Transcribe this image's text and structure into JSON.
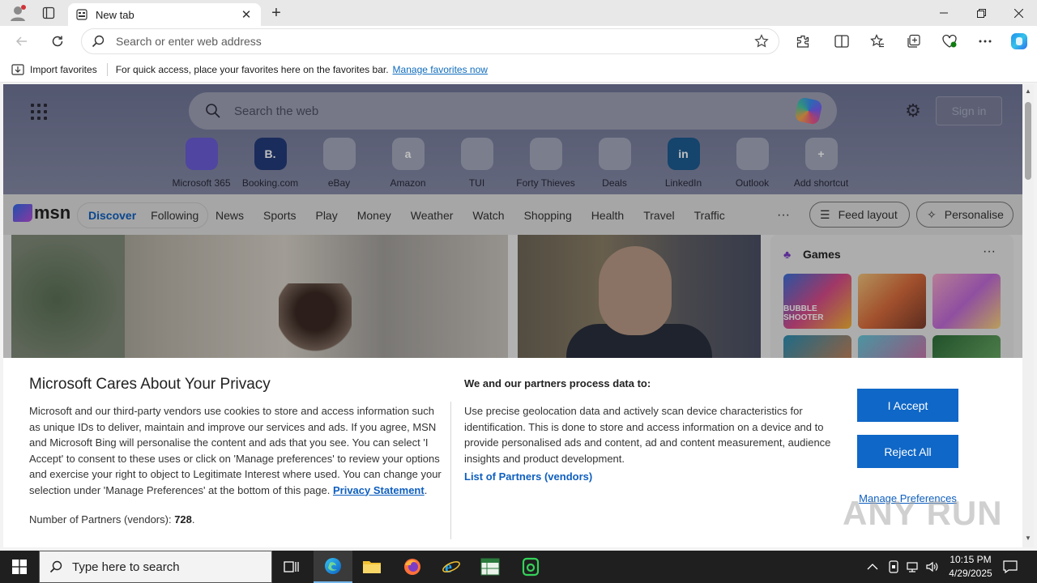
{
  "browser": {
    "tab": {
      "title": "New tab"
    },
    "address_bar": {
      "placeholder": "Search or enter web address"
    }
  },
  "favorites_bar": {
    "import_label": "Import favorites",
    "message": "For quick access, place your favorites here on the favorites bar.",
    "link": "Manage favorites now"
  },
  "newtab": {
    "search_placeholder": "Search the web",
    "sign_in": "Sign in",
    "shortcuts": [
      {
        "label": "Microsoft 365",
        "icon": "microsoft-365-icon",
        "glyph": "",
        "color": "#6b5cd6"
      },
      {
        "label": "Booking.com",
        "icon": "booking-icon",
        "glyph": "B.",
        "color": "#233b7a"
      },
      {
        "label": "eBay",
        "icon": "ebay-icon",
        "glyph": "",
        "color": "#a5a8bc"
      },
      {
        "label": "Amazon",
        "icon": "amazon-icon",
        "glyph": "a",
        "color": "#a5a8bc"
      },
      {
        "label": "TUI",
        "icon": "tui-icon",
        "glyph": "",
        "color": "#a5a8bc"
      },
      {
        "label": "Forty Thieves",
        "icon": "forty-thieves-icon",
        "glyph": "",
        "color": "#a5a8bc"
      },
      {
        "label": "Deals",
        "icon": "deals-icon",
        "glyph": "",
        "color": "#a5a8bc"
      },
      {
        "label": "LinkedIn",
        "icon": "linkedin-icon",
        "glyph": "in",
        "color": "#1c5b91"
      },
      {
        "label": "Outlook",
        "icon": "outlook-icon",
        "glyph": "",
        "color": "#a5a8bc"
      },
      {
        "label": "Add shortcut",
        "icon": "plus-icon",
        "glyph": "+",
        "color": "#a5a8bc"
      }
    ]
  },
  "msn": {
    "logo": "msn",
    "pill_tabs": [
      "Discover",
      "Following"
    ],
    "active_tab": "Discover",
    "nav": [
      "News",
      "Sports",
      "Play",
      "Money",
      "Weather",
      "Watch",
      "Shopping",
      "Health",
      "Travel",
      "Traffic"
    ],
    "more": "···",
    "feed_layout": "Feed layout",
    "personalise": "Personalise",
    "games": {
      "title": "Games",
      "more": "···",
      "tile_text": "BUBBLE SHOOTER"
    }
  },
  "privacy": {
    "title": "Microsoft Cares About Your Privacy",
    "body": "Microsoft and our third-party vendors use cookies to store and access information such as unique IDs to deliver, maintain and improve our services and ads. If you agree, MSN and Microsoft Bing will personalise the content and ads that you see. You can select 'I Accept' to consent to these uses or click on 'Manage preferences' to review your options and exercise your right to object to Legitimate Interest where used.  You can change your selection under 'Manage Preferences' at the bottom of this page.",
    "privacy_link": "Privacy Statement",
    "partners_label": "Number of Partners (vendors):",
    "partners_count": "728",
    "purposes_title": "We and our partners process data to:",
    "purposes_text": "Use precise geolocation data and actively scan device characteristics for identification. This is done to store and access information on a device and to provide personalised ads and content, ad and content measurement, audience insights and product development.",
    "partners_list_link": "List of Partners (vendors)",
    "accept": "I Accept",
    "reject": "Reject All",
    "manage": "Manage Preferences"
  },
  "watermark": "ANY RUN",
  "taskbar": {
    "search_placeholder": "Type here to search",
    "time": "10:15 PM",
    "date": "4/29/2025"
  }
}
